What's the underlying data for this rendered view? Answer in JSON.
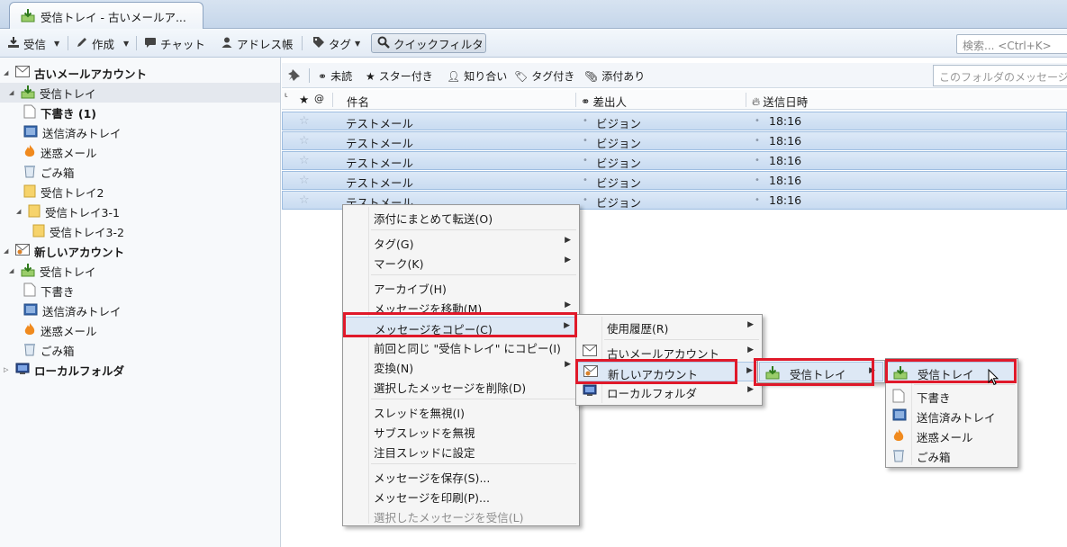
{
  "tab": {
    "title": "受信トレイ - 古いメールア..."
  },
  "toolbar": {
    "get_mail": "受信",
    "compose": "作成",
    "chat": "チャット",
    "address_book": "アドレス帳",
    "tag": "タグ",
    "quick_filter": "クイックフィルタ",
    "search_placeholder": "検索... <Ctrl+K>"
  },
  "folders": {
    "account1": "古いメールアカウント",
    "inbox": "受信トレイ",
    "drafts": "下書き (1)",
    "sent": "送信済みトレイ",
    "junk": "迷惑メール",
    "trash": "ごみ箱",
    "inbox2": "受信トレイ2",
    "inbox3_1": "受信トレイ3-1",
    "inbox3_2": "受信トレイ3-2",
    "account2": "新しいアカウント",
    "inbox_b": "受信トレイ",
    "drafts_b": "下書き",
    "sent_b": "送信済みトレイ",
    "junk_b": "迷惑メール",
    "trash_b": "ごみ箱",
    "local": "ローカルフォルダ"
  },
  "quickfilter": {
    "unread": "未読",
    "starred": "スター付き",
    "contacts": "知り合い",
    "tagged": "タグ付き",
    "attachment": "添付あり",
    "search_placeholder": "このフォルダのメッセージを"
  },
  "columns": {
    "subject": "件名",
    "sender": "差出人",
    "date": "送信日時"
  },
  "messages": [
    {
      "subject": "テストメール",
      "sender": "ビジョン",
      "date": "18:16"
    },
    {
      "subject": "テストメール",
      "sender": "ビジョン",
      "date": "18:16"
    },
    {
      "subject": "テストメール",
      "sender": "ビジョン",
      "date": "18:16"
    },
    {
      "subject": "テストメール",
      "sender": "ビジョン",
      "date": "18:16"
    },
    {
      "subject": "テストメール",
      "sender": "ビジョン",
      "date": "18:16"
    }
  ],
  "context_menu": {
    "forward_attached": "添付にまとめて転送(O)",
    "tag": "タグ(G)",
    "mark": "マーク(K)",
    "archive": "アーカイブ(H)",
    "move": "メッセージを移動(M)",
    "copy": "メッセージをコピー(C)",
    "copy_again": "前回と同じ \"受信トレイ\" にコピー(I)",
    "convert": "変換(N)",
    "delete": "選択したメッセージを削除(D)",
    "ignore_thread": "スレッドを無視(I)",
    "ignore_subthread": "サブスレッドを無視",
    "watch_thread": "注目スレッドに設定",
    "save": "メッセージを保存(S)...",
    "print": "メッセージを印刷(P)...",
    "get_selected": "選択したメッセージを受信(L)"
  },
  "copy_submenu": {
    "recent": "使用履歴(R)",
    "old_account": "古いメールアカウント",
    "new_account": "新しいアカウント",
    "local": "ローカルフォルダ"
  },
  "account_submenu": {
    "inbox": "受信トレイ"
  },
  "inbox_submenu": {
    "inbox": "受信トレイ",
    "drafts": "下書き",
    "sent": "送信済みトレイ",
    "junk": "迷惑メール",
    "trash": "ごみ箱"
  },
  "colors": {
    "highlight": "#e0192a",
    "selection": "#c8dbf1"
  }
}
